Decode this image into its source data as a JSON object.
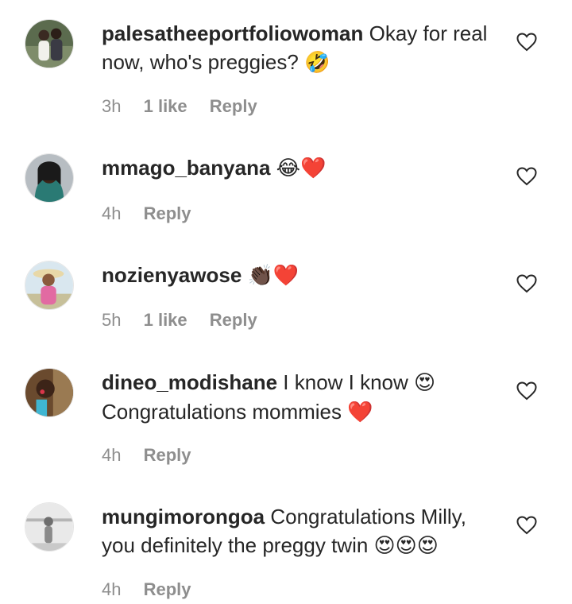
{
  "comments": [
    {
      "username": "palesatheeportfoliowoman",
      "text": "Okay for real now, who's preggies?",
      "emoji": "🤣",
      "time": "3h",
      "likes": "1 like",
      "reply": "Reply"
    },
    {
      "username": "mmago_banyana",
      "text": "",
      "emoji": "😂❤️",
      "time": "4h",
      "likes": "",
      "reply": "Reply"
    },
    {
      "username": "nozienyawose",
      "text": "",
      "emoji": "👏🏿❤️",
      "time": "5h",
      "likes": "1 like",
      "reply": "Reply"
    },
    {
      "username": "dineo_modishane",
      "text": "I know I know",
      "emoji": "😍",
      "text2": "Congratulations mommies",
      "emoji2": "❤️",
      "time": "4h",
      "likes": "",
      "reply": "Reply"
    },
    {
      "username": "mungimorongoa",
      "text": "Congratulations Milly, you definitely the preggy twin",
      "emoji": "😍😍😍",
      "time": "4h",
      "likes": "",
      "reply": "Reply"
    }
  ],
  "icons": {
    "like": "heart-outline-icon"
  },
  "colors": {
    "text": "#262626",
    "meta": "#8e8e8e",
    "heart_stroke": "#262626"
  }
}
